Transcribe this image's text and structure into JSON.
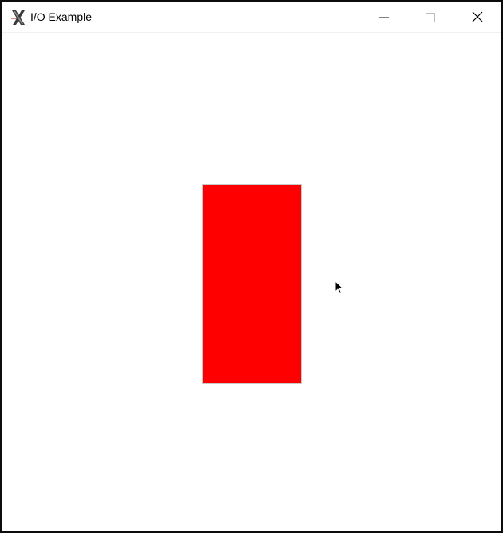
{
  "window": {
    "title": "I/O Example",
    "icon": "x-app-icon",
    "controls": {
      "minimize": "minimize-icon",
      "maximize": "maximize-icon",
      "close": "close-icon"
    }
  },
  "canvas": {
    "background": "#ffffff",
    "shape": {
      "kind": "rectangle",
      "fill": "#ff0000"
    }
  },
  "colors": {
    "titlebar_bg": "#ffffff",
    "title_text": "#000000",
    "shape_fill": "#ff0000"
  }
}
